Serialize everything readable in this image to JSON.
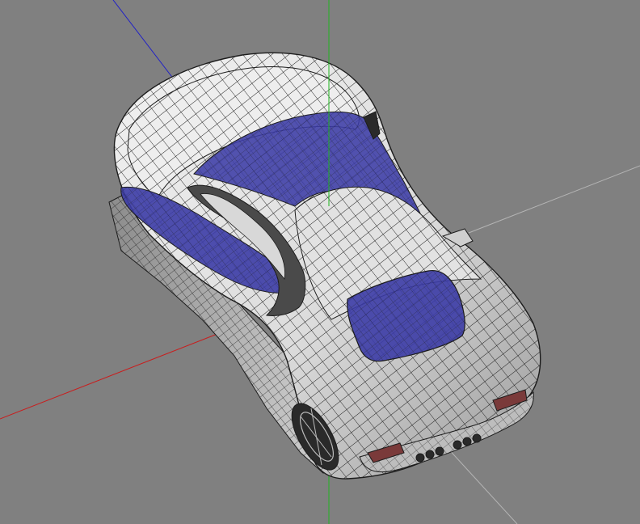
{
  "viewport": {
    "kind": "3d-wireframe-viewport",
    "background_color": "#808080",
    "model": {
      "name": "car-body-wireframe",
      "surface_color": "#e6e6e6",
      "wire_color": "#1c1c1c",
      "glass_color": "#3c3ca6",
      "dark_parts_color": "#2a2a2a",
      "tail_light_color": "#7a3a3a"
    },
    "axes": [
      {
        "name": "x-axis",
        "color": "#c81e1e"
      },
      {
        "name": "y-axis",
        "color": "#1fb41f"
      },
      {
        "name": "z-axis",
        "color": "#1e1ec8"
      }
    ],
    "grid_line_color": "#b4b4b4"
  }
}
